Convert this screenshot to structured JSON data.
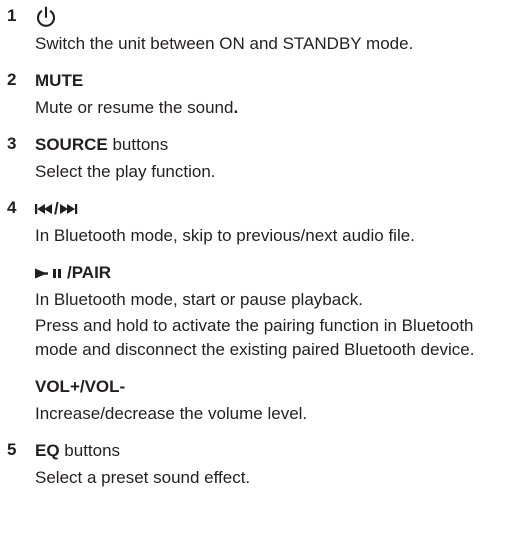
{
  "items": [
    {
      "number": "1",
      "icon": "power-icon",
      "description": "Switch the unit between ON and STANDBY mode."
    },
    {
      "number": "2",
      "title": "MUTE",
      "description_pre": "Mute or resume the sound",
      "description_end": "."
    },
    {
      "number": "3",
      "title": "SOURCE",
      "title_suffix": " buttons",
      "description": "Select the play function."
    },
    {
      "number": "4",
      "icon": "previous-next-icon",
      "icon_separator": "/",
      "description": "In Bluetooth mode, skip to previous/next audio file.",
      "sub_items": [
        {
          "icon": "play-pause-icon",
          "title": "/PAIR",
          "descriptions": [
            "In Bluetooth mode, start or pause playback.",
            "Press and hold to activate the pairing function in Bluetooth mode and disconnect the existing paired Bluetooth device."
          ]
        },
        {
          "title": "VOL+/VOL-",
          "descriptions": [
            "Increase/decrease the volume level."
          ]
        }
      ]
    },
    {
      "number": "5",
      "title": "EQ",
      "title_suffix": " buttons",
      "description": "Select a preset sound effect."
    }
  ]
}
